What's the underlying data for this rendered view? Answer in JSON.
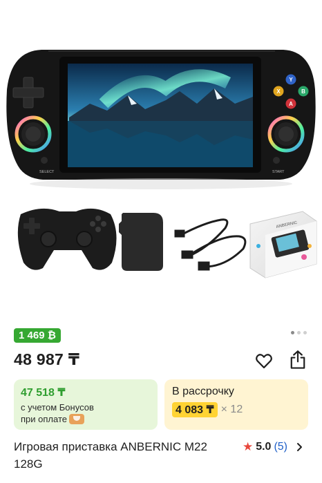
{
  "gallery": {
    "select_label": "SELECT",
    "start_label": "START",
    "face_buttons": [
      "Y",
      "X",
      "B",
      "A"
    ],
    "box_brand": "ANBERNIC",
    "slides": 3,
    "active_slide": 1
  },
  "product": {
    "bonus_badge": "1 469 ₿",
    "price": "48 987 ₸",
    "title": "Игровая приставка ANBERNIC M22 128G"
  },
  "bonus_card": {
    "amount": "47 518 ₸",
    "line1": "с учетом Бонусов",
    "line2": "при оплате"
  },
  "installment_card": {
    "label": "В рассрочку",
    "monthly": "4 083 ₸",
    "months": "× 12"
  },
  "rating": {
    "value": "5.0",
    "count": "(5)"
  },
  "icons": [
    "heart-icon",
    "share-icon",
    "star-icon",
    "chevron-right-icon",
    "kaspi-grin-icon"
  ],
  "colors": {
    "bonus_green": "#36a832",
    "installment_yellow": "#ffd333",
    "star_red": "#e8473c",
    "link_blue": "#2060c8"
  }
}
